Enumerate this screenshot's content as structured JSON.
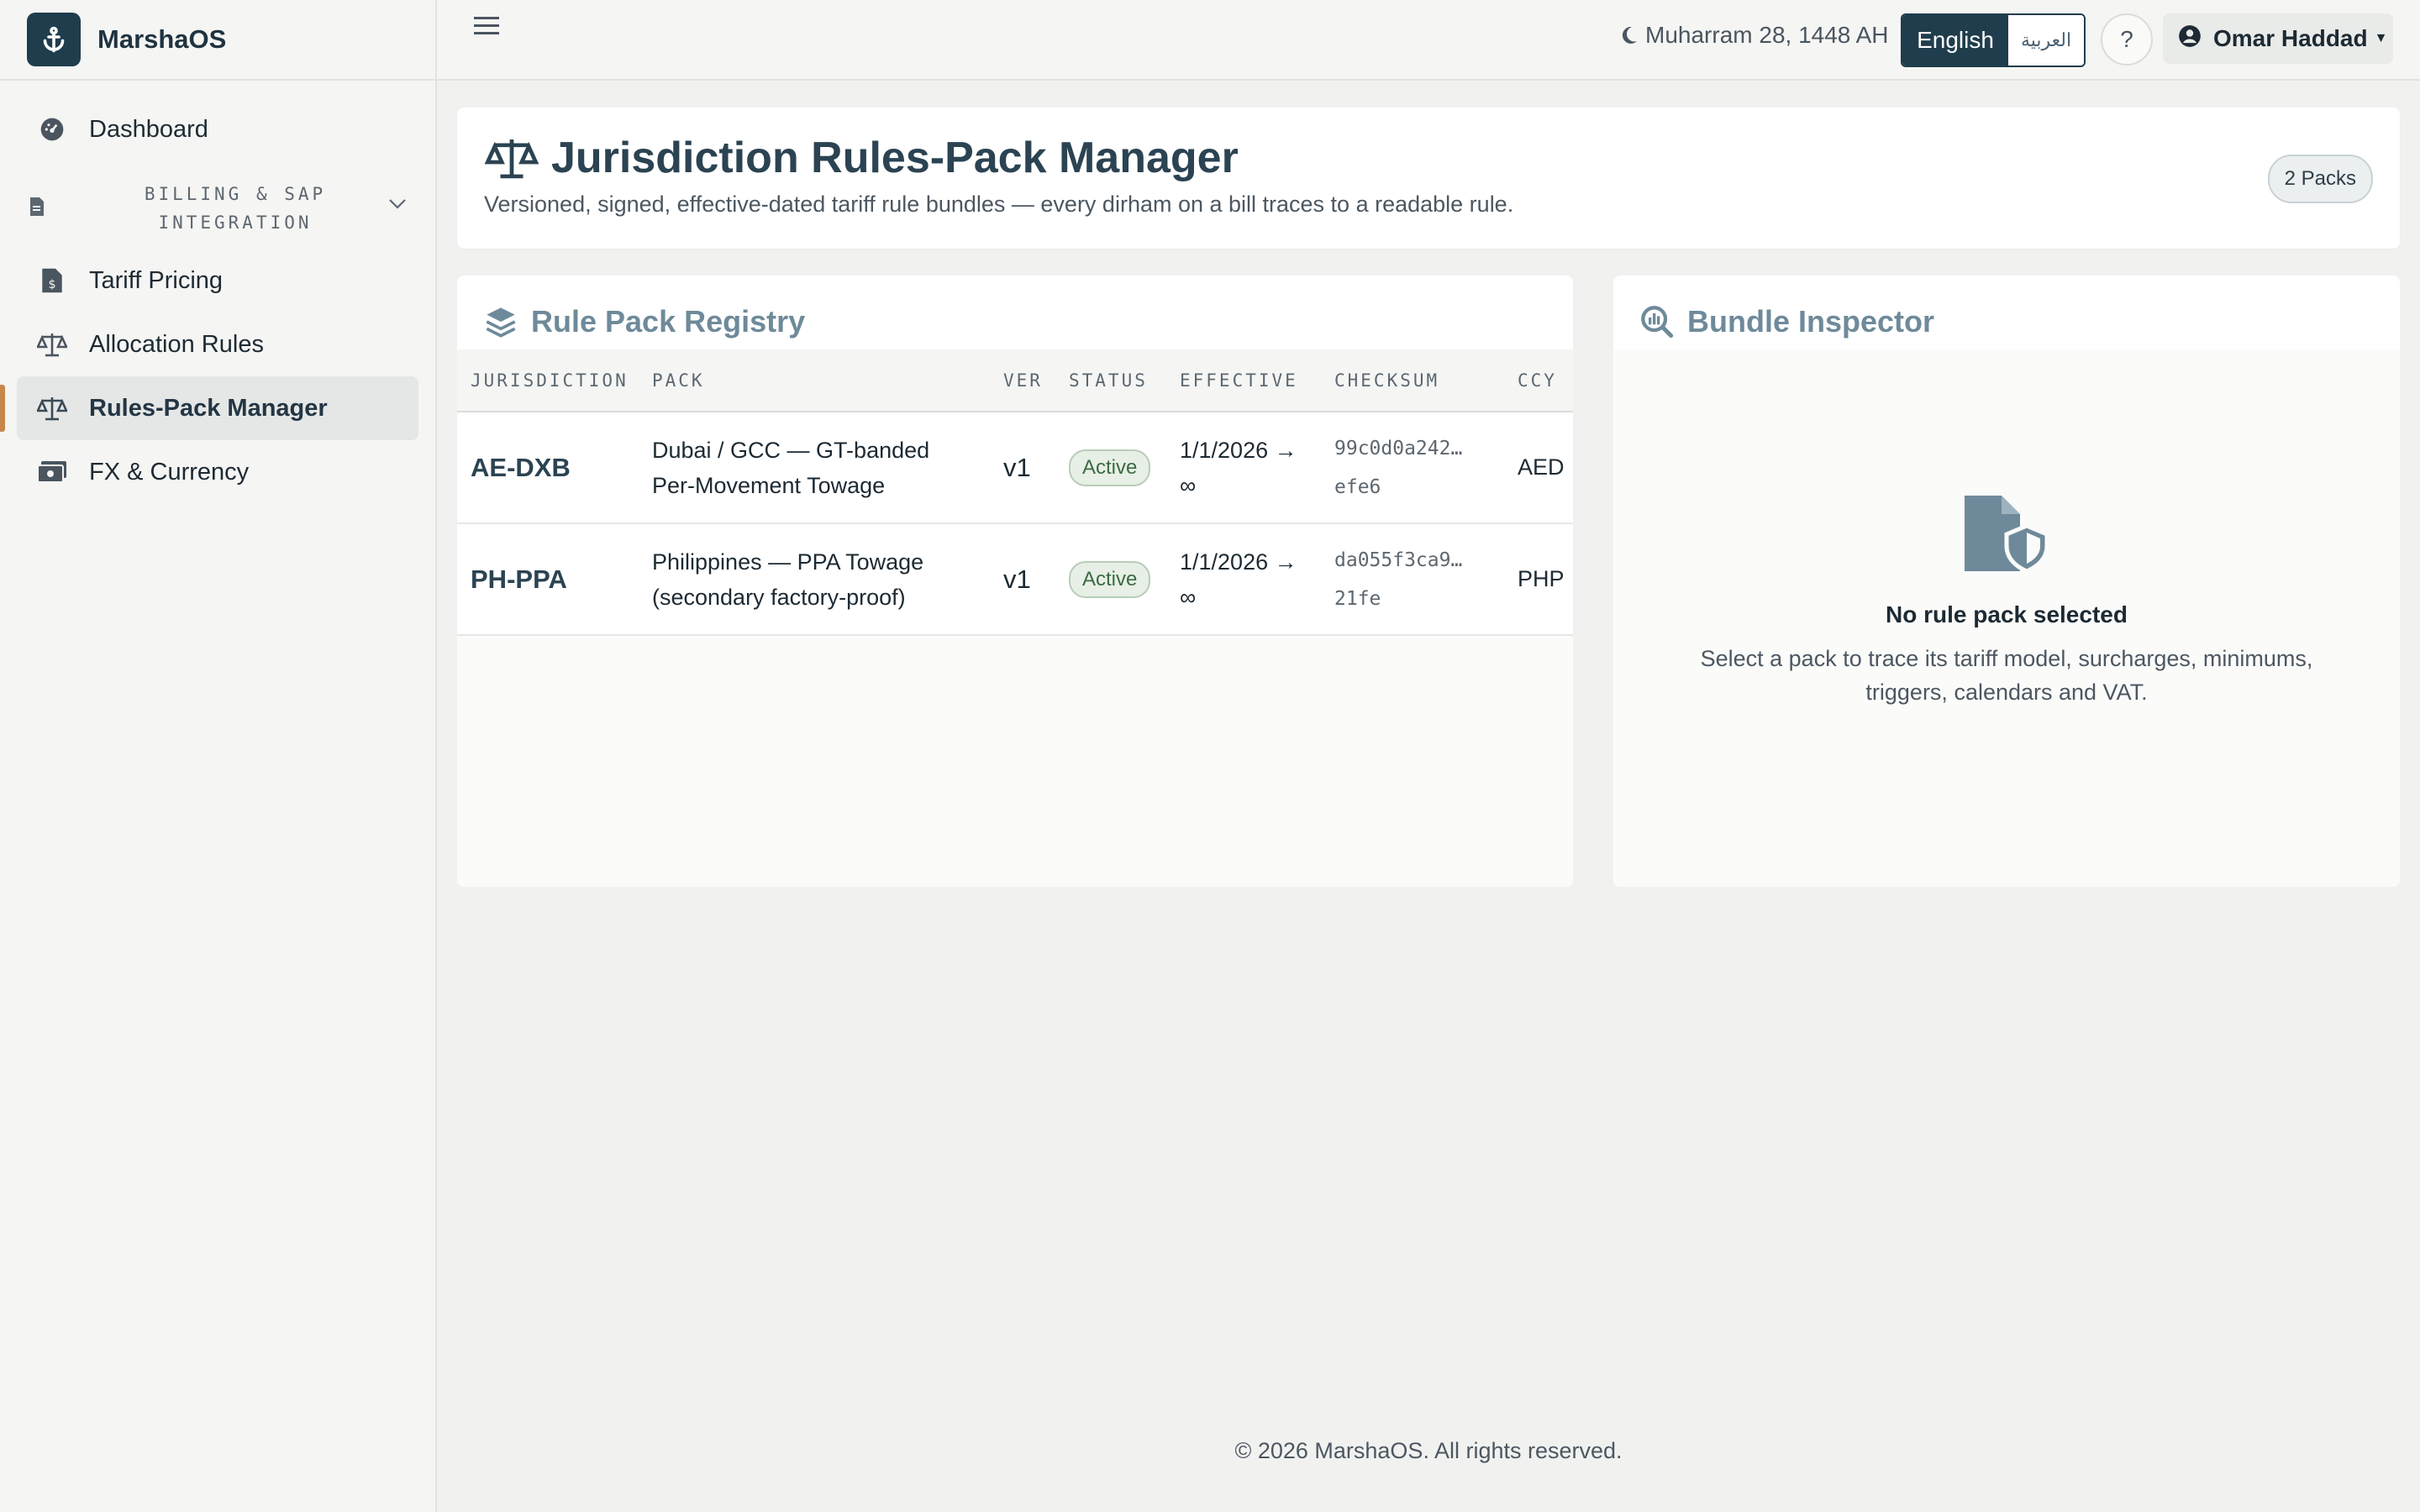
{
  "app": {
    "name": "MarshaOS"
  },
  "sidebar": {
    "items": [
      {
        "label": "Dashboard"
      },
      {
        "label": "Tariff Pricing"
      },
      {
        "label": "Allocation Rules"
      },
      {
        "label": "Rules-Pack Manager"
      },
      {
        "label": "FX & Currency"
      }
    ],
    "group": {
      "line1": "BILLING & SAP",
      "line2": "INTEGRATION"
    }
  },
  "topbar": {
    "hijri_date": "Muharram 28, 1448 AH",
    "lang_en": "English",
    "lang_ar": "العربية",
    "help": "?",
    "user": "Omar Haddad"
  },
  "header": {
    "title": "Jurisdiction Rules-Pack Manager",
    "subtitle": "Versioned, signed, effective-dated tariff rule bundles — every dirham on a bill traces to a readable rule.",
    "packs_badge": "2 Packs"
  },
  "registry": {
    "title": "Rule Pack Registry",
    "columns": [
      "JURISDICTION",
      "PACK",
      "VER",
      "STATUS",
      "EFFECTIVE",
      "CHECKSUM",
      "CCY"
    ],
    "rows": [
      {
        "jurisdiction": "AE-DXB",
        "pack_line1": "Dubai / GCC — GT-banded",
        "pack_line2": "Per-Movement Towage",
        "ver": "v1",
        "status": "Active",
        "eff_line1": "1/1/2026 →",
        "eff_line2": "∞",
        "chk_line1": "99c0d0a242…",
        "chk_line2": "efe6",
        "ccy": "AED"
      },
      {
        "jurisdiction": "PH-PPA",
        "pack_line1": "Philippines — PPA Towage",
        "pack_line2": "(secondary factory-proof)",
        "ver": "v1",
        "status": "Active",
        "eff_line1": "1/1/2026 →",
        "eff_line2": "∞",
        "chk_line1": "da055f3ca9…",
        "chk_line2": "21fe",
        "ccy": "PHP"
      }
    ]
  },
  "inspector": {
    "title": "Bundle Inspector",
    "empty_title": "No rule pack selected",
    "empty_desc": "Select a pack to trace its tariff model, surcharges, minimums, triggers, calendars and VAT."
  },
  "footer": {
    "text": "© 2026 MarshaOS. All rights reserved."
  },
  "colors": {
    "brand": "#1f3d4d",
    "accent": "#c7864a",
    "active_status": "#3d6a43"
  }
}
